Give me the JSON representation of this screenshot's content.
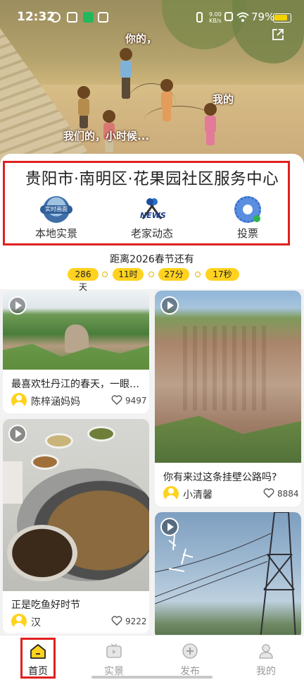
{
  "status_bar": {
    "time": "12:32",
    "net_speed_value": "9.00",
    "net_speed_unit": "KB/s",
    "battery": "79%"
  },
  "hero": {
    "speech_1": "你的，",
    "speech_2": "我的",
    "speech_3": "我们的，小时候..."
  },
  "info": {
    "title": "贵阳市·南明区·花果园社区服务中心",
    "actions": [
      {
        "label": "本地实景",
        "icon": "live-view-icon",
        "badge": "实时画面"
      },
      {
        "label": "老家动态",
        "icon": "news-microphone-icon",
        "badge": "NEWS"
      },
      {
        "label": "投票",
        "icon": "qr-code-icon"
      }
    ],
    "countdown_label": "距离2026春节还有",
    "countdown": {
      "days": "286天",
      "hours": "11时",
      "minutes": "27分",
      "seconds": "17秒"
    }
  },
  "feed": [
    {
      "title": "最喜欢牡丹江的春天，一眼…",
      "user": "陈梓涵妈妈",
      "likes": "9497"
    },
    {
      "title": "你有来过这条挂壁公路吗?",
      "user": "小清馨",
      "likes": "8884"
    },
    {
      "title": "正是吃鱼好时节",
      "user": "汉",
      "likes": "9222"
    }
  ],
  "nav": [
    {
      "label": "首页",
      "icon": "home-icon",
      "active": true
    },
    {
      "label": "实景",
      "icon": "tv-icon"
    },
    {
      "label": "发布",
      "icon": "plus-circle-icon"
    },
    {
      "label": "我的",
      "icon": "profile-icon"
    }
  ],
  "colors": {
    "accent": "#ffd21f",
    "highlight": "#e02020"
  }
}
